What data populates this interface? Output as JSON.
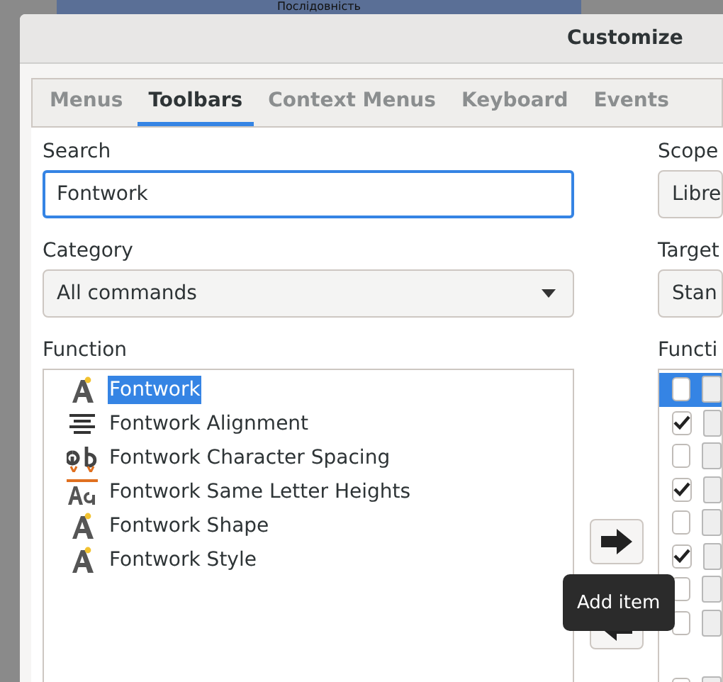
{
  "background_window": {
    "title": "Послідовність"
  },
  "window": {
    "title": "Customize"
  },
  "tabs": [
    {
      "label": "Menus",
      "selected": false
    },
    {
      "label": "Toolbars",
      "selected": true
    },
    {
      "label": "Context Menus",
      "selected": false
    },
    {
      "label": "Keyboard",
      "selected": false
    },
    {
      "label": "Events",
      "selected": false
    }
  ],
  "search": {
    "label": "Search",
    "value": "Fontwork"
  },
  "category": {
    "label": "Category",
    "value": "All commands"
  },
  "functions": {
    "label": "Function",
    "items": [
      {
        "label": "Fontwork",
        "kind": "fontwork",
        "selected": true
      },
      {
        "label": "Fontwork Alignment",
        "kind": "align",
        "selected": false
      },
      {
        "label": "Fontwork Character Spacing",
        "kind": "spacing",
        "selected": false
      },
      {
        "label": "Fontwork Same Letter Heights",
        "kind": "heights",
        "selected": false
      },
      {
        "label": "Fontwork Shape",
        "kind": "fontwork",
        "selected": false
      },
      {
        "label": "Fontwork Style",
        "kind": "fontwork",
        "selected": false
      }
    ]
  },
  "tooltip": {
    "text": "Add item"
  },
  "scope": {
    "label": "Scope",
    "value": "Libre"
  },
  "target": {
    "label": "Target",
    "value": "Stan"
  },
  "toolbar_entries": {
    "label": "Functi",
    "items": [
      {
        "kind": "entry",
        "checked": false,
        "selected": true
      },
      {
        "kind": "entry",
        "checked": true,
        "selected": false
      },
      {
        "kind": "entry",
        "checked": false,
        "selected": false
      },
      {
        "kind": "entry",
        "checked": true,
        "selected": false
      },
      {
        "kind": "entry",
        "checked": false,
        "selected": false
      },
      {
        "kind": "entry",
        "checked": true,
        "selected": false
      },
      {
        "kind": "entry",
        "checked": false,
        "selected": false
      },
      {
        "kind": "entry",
        "checked": false,
        "selected": false
      },
      {
        "kind": "separator"
      },
      {
        "kind": "entry",
        "checked": false,
        "selected": false
      }
    ]
  }
}
